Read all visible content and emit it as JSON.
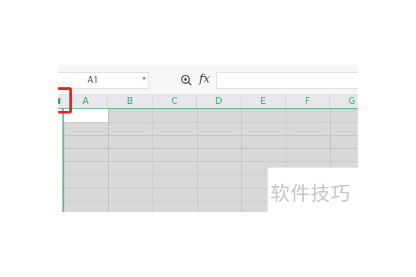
{
  "formula_bar": {
    "name_box_value": "A1",
    "name_box_arrow": "▾",
    "zoom_icon": "zoom-in-magnifier-icon",
    "fx_label": "fx",
    "formula_value": ""
  },
  "columns": [
    "A",
    "B",
    "C",
    "D",
    "E",
    "F",
    "G"
  ],
  "grid": {
    "visible_rows": 8,
    "active_cell": "A1"
  },
  "watermark": "软件技巧",
  "colors": {
    "accent_green": "#3aa673",
    "highlight_red": "#d62b2b",
    "selected_fill": "#d8d8d8"
  }
}
